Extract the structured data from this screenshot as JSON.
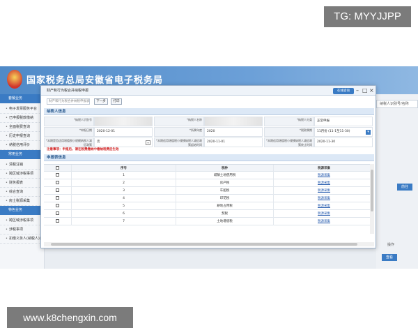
{
  "watermark_top": "TG: MYYJJPP",
  "watermark_bottom": "www.k8chengxin.com",
  "site": {
    "title": "国家税务总局安徽省电子税务局"
  },
  "sidebar": {
    "items": [
      {
        "type": "category",
        "label": "套餐业务"
      },
      {
        "type": "item",
        "label": "电子发票服务平台"
      },
      {
        "type": "item",
        "label": "已申报税款缴纳"
      },
      {
        "type": "item",
        "label": "全面税费查询"
      },
      {
        "type": "item",
        "label": "历史申报查询"
      },
      {
        "type": "item",
        "label": "纳税信用评价"
      },
      {
        "type": "category",
        "label": "常用业务"
      },
      {
        "type": "item",
        "label": "清税注销"
      },
      {
        "type": "item",
        "label": "跨区域涉税事项"
      },
      {
        "type": "item",
        "label": "财务报表"
      },
      {
        "type": "item",
        "label": "综合查询"
      },
      {
        "type": "item",
        "label": "房土税源采集"
      },
      {
        "type": "category",
        "label": "特色业务"
      },
      {
        "type": "item",
        "label": "跨区域涉税事项"
      },
      {
        "type": "item",
        "label": "涉税事项"
      },
      {
        "type": "item",
        "label": "扣缴义务人(纳税人)自助申报"
      }
    ]
  },
  "right_panel": {
    "user_label": "纳税人识别号/名称",
    "btn1": "前往",
    "label": "操作",
    "btn2": "查看"
  },
  "dialog": {
    "title": "财产和行为税合并纳税申报",
    "online_help": "在线咨询",
    "controls": {
      "help": "?",
      "minimize": "–",
      "maximize": "□",
      "close": "×"
    },
    "toolbar": {
      "input_placeholder": "财产和行为税合并纳税申报表",
      "next_label": "下一步",
      "print_label": "打印"
    },
    "section1_title": "纳税人信息",
    "form": {
      "row1": [
        {
          "label": "*纳税人识别号",
          "value": "",
          "blur": true
        },
        {
          "label": "*纳税人名称",
          "value": "",
          "blur": true
        },
        {
          "label": "*纳税人分类",
          "value": "正常申报"
        }
      ],
      "row2": [
        {
          "label": "*申报日期",
          "value": "2020-12-01"
        },
        {
          "label": "*所属年度",
          "value": "2020"
        },
        {
          "label": "*税款属期",
          "value": "11月份 (11-1至11-30)",
          "select": true
        }
      ],
      "row3": [
        {
          "label": "*本期是否适用增值税小规模纳税人减征政策",
          "value": "否",
          "select": true
        },
        {
          "label": "*本期适用增值税小规模纳税人减征政策起始时间",
          "value": "2020-11-01"
        },
        {
          "label": "*本期适用增值税小规模纳税人减征政策终止时间",
          "value": "2020-11-30"
        }
      ]
    },
    "notice": "注意事项：申报后，请在税费缴纳中缴纳税费后生效",
    "section2_title": "申报表信息",
    "table": {
      "headers": [
        "",
        "序号",
        "税种",
        "税源采集"
      ],
      "rows": [
        {
          "num": "1",
          "tax": "城镇土地使用税",
          "op": "税源采集"
        },
        {
          "num": "2",
          "tax": "房产税",
          "op": "税源采集"
        },
        {
          "num": "3",
          "tax": "车船税",
          "op": "税源采集"
        },
        {
          "num": "4",
          "tax": "印花税",
          "op": "税源采集"
        },
        {
          "num": "5",
          "tax": "耕地占用税",
          "op": "税源采集"
        },
        {
          "num": "6",
          "tax": "契税",
          "op": "税源采集"
        },
        {
          "num": "7",
          "tax": "土地增值税",
          "op": "税源采集"
        }
      ]
    }
  },
  "colors": {
    "header_blue": "#4f8ac8",
    "accent_blue": "#3a7bc4",
    "notice_red": "#d12222",
    "link_blue": "#2b5fb0"
  }
}
